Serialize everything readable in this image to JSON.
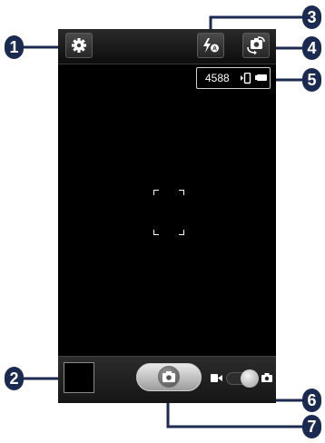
{
  "screen": {
    "status": {
      "remaining_shots": "4588",
      "storage_icon": "phone-storage-icon",
      "battery_icon": "battery-icon"
    },
    "top_bar": {
      "settings_icon": "gear-icon",
      "flash_icon": "flash-auto-icon",
      "switch_camera_icon": "switch-camera-icon"
    },
    "bottom_bar": {
      "thumbnail": "image-viewer-thumbnail",
      "shutter_icon": "camera-icon",
      "mode_video_icon": "video-camera-icon",
      "mode_photo_icon": "camera-icon"
    }
  },
  "callouts": [
    "1",
    "2",
    "3",
    "4",
    "5",
    "6",
    "7"
  ],
  "colors": {
    "callout_fill": "#1b2a50",
    "screen_bg": "#000000"
  }
}
